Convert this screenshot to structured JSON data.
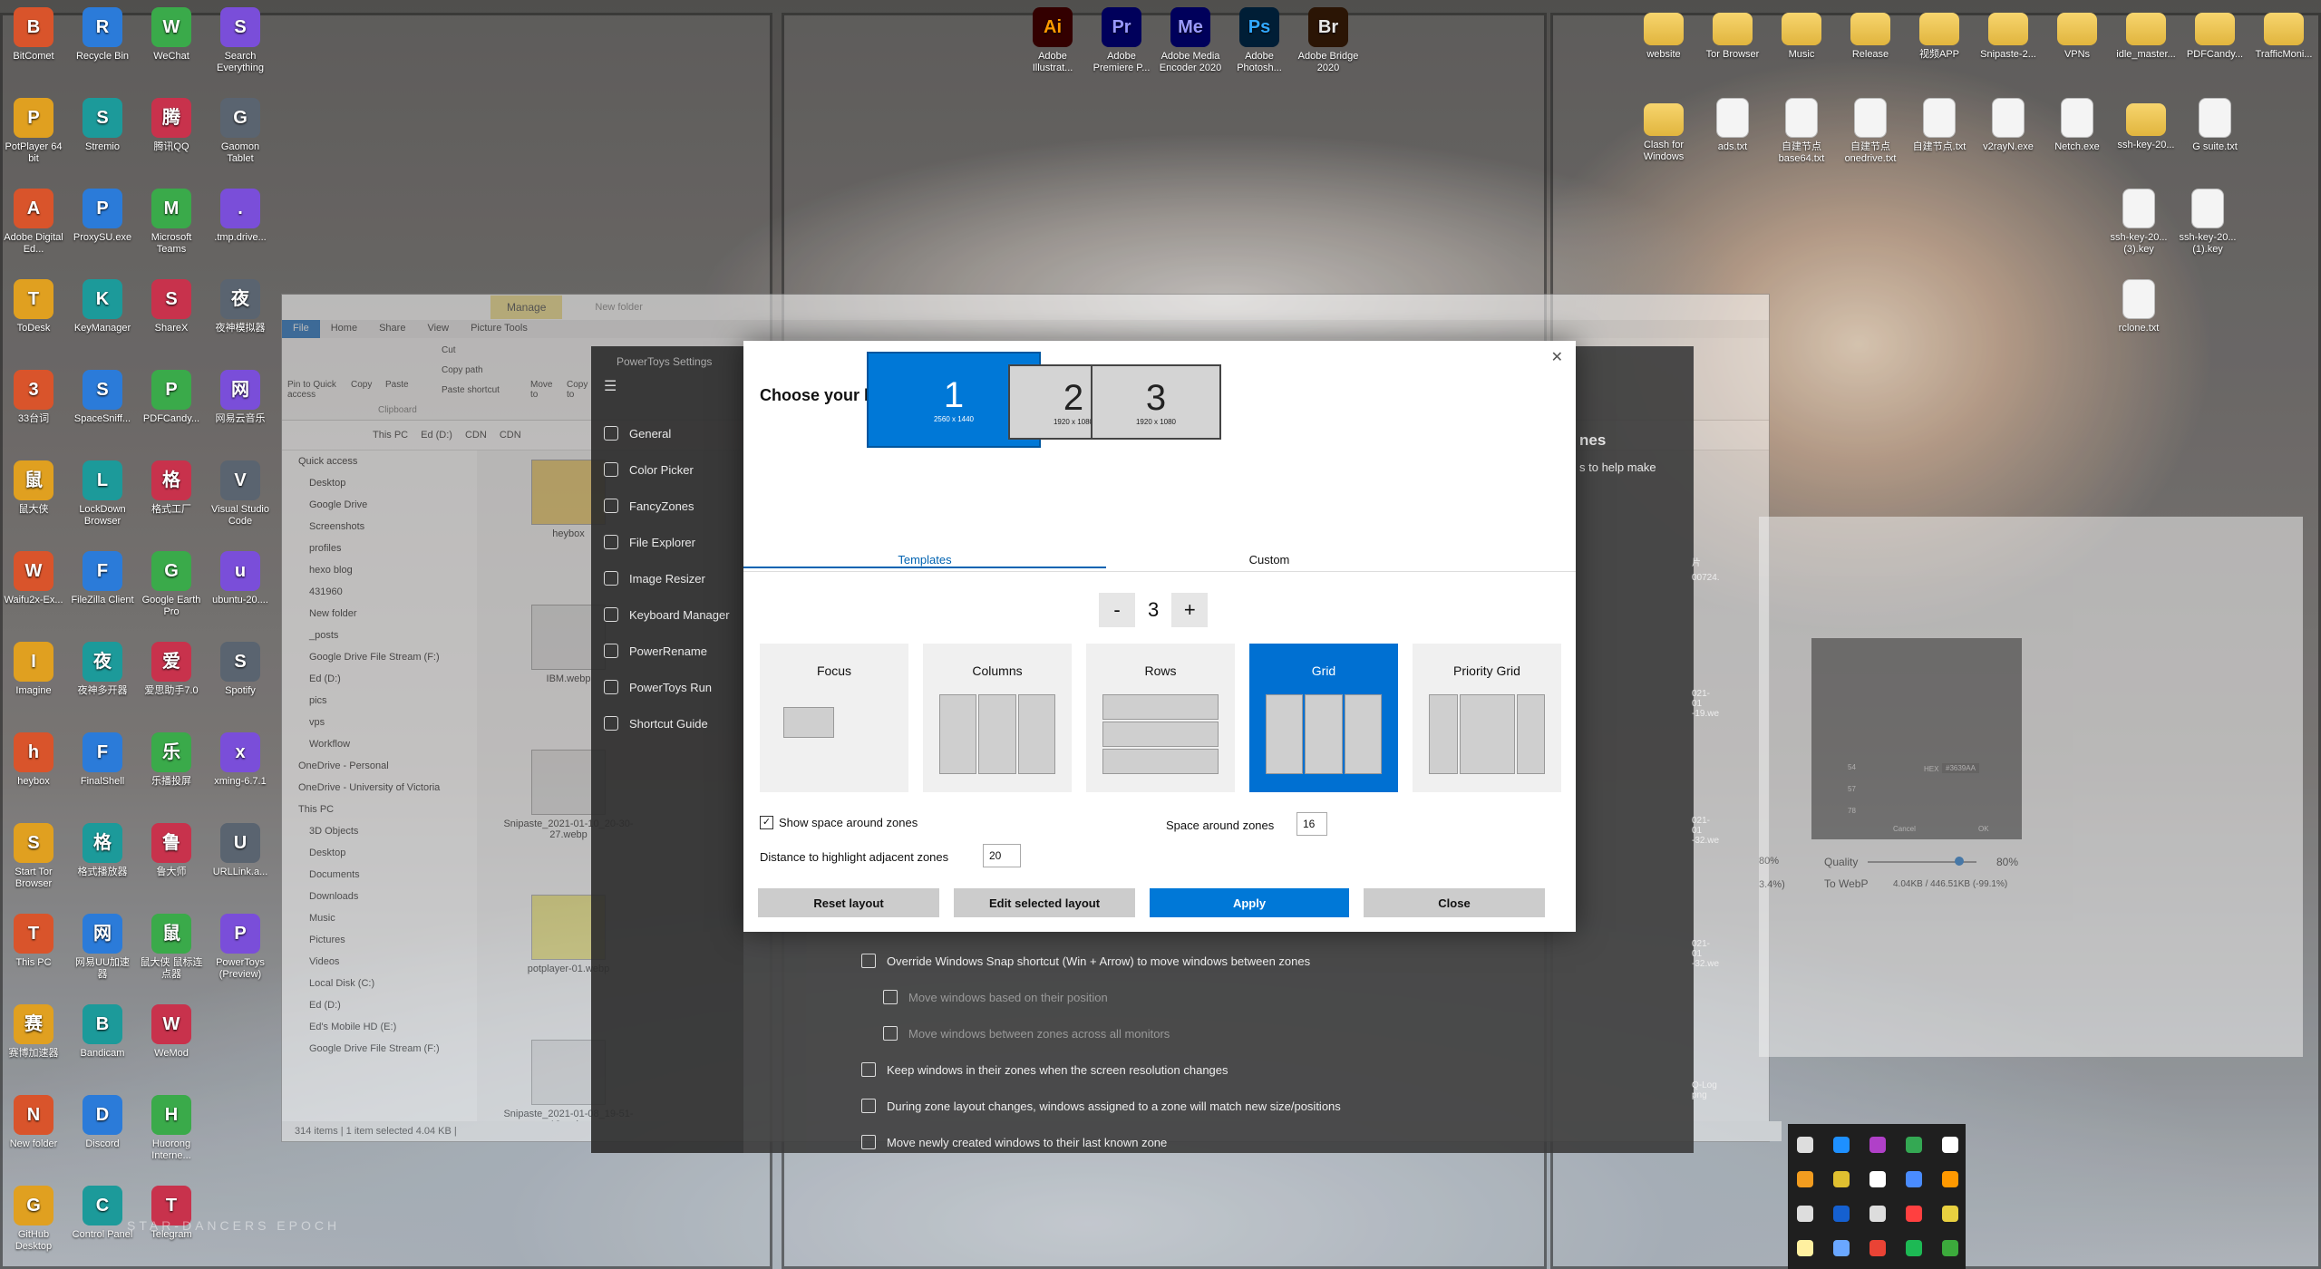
{
  "desktop": {
    "left_icons": [
      [
        "BitComet",
        "Recycle Bin",
        "WeChat",
        "Search Everything"
      ],
      [
        "PotPlayer 64 bit",
        "Stremio",
        "腾讯QQ",
        "Gaomon Tablet"
      ],
      [
        "Adobe Digital Ed...",
        "ProxySU.exe",
        "Microsoft Teams",
        ".tmp.drive..."
      ],
      [
        "ToDesk",
        "KeyManager",
        "ShareX",
        "夜神模拟器"
      ],
      [
        "33台词",
        "SpaceSniff...",
        "PDFCandy...",
        "网易云音乐"
      ],
      [
        "鼠大侠",
        "LockDown Browser",
        "格式工厂",
        "Visual Studio Code"
      ],
      [
        "Waifu2x-Ex...",
        "FileZilla Client",
        "Google Earth Pro",
        "ubuntu-20...."
      ],
      [
        "Imagine",
        "夜神多开器",
        "爱思助手7.0",
        "Spotify"
      ],
      [
        "heybox",
        "FinalShell",
        "乐播投屏",
        "xming-6.7.1"
      ],
      [
        "Start Tor Browser",
        "格式播放器",
        "鲁大师",
        "URLLink.a..."
      ],
      [
        "This PC",
        "网易UU加速器",
        "鼠大侠 鼠标连点器",
        "PowerToys (Preview)"
      ],
      [
        "赛博加速器",
        "Bandicam",
        "WeMod",
        ""
      ],
      [
        "New folder",
        "Discord",
        "Huorong Interne...",
        ""
      ],
      [
        "GitHub Desktop",
        "Control Panel",
        "Telegram",
        ""
      ]
    ],
    "top_center_icons": [
      {
        "abbr": "Ai",
        "label": "Adobe Illustrat...",
        "color": "#330000",
        "fg": "#ff9a00"
      },
      {
        "abbr": "Pr",
        "label": "Adobe Premiere P...",
        "color": "#00005b",
        "fg": "#9999ff"
      },
      {
        "abbr": "Me",
        "label": "Adobe Media Encoder 2020",
        "color": "#00005b",
        "fg": "#9999ff"
      },
      {
        "abbr": "Ps",
        "label": "Adobe Photosh...",
        "color": "#001e36",
        "fg": "#31a8ff"
      },
      {
        "abbr": "Br",
        "label": "Adobe Bridge 2020",
        "color": "#2b1505",
        "fg": "#e8e8e8"
      }
    ],
    "right_icons_row1": [
      "website",
      "Tor Browser",
      "Music",
      "Release",
      "视频APP",
      "Snipaste-2...",
      "VPNs",
      "idle_master...",
      "PDFCandy...",
      "TrafficMoni..."
    ],
    "right_icons_row2": [
      "Clash for Windows",
      "ads.txt",
      "自建节点 base64.txt",
      "自建节点 onedrive.txt",
      "自建节点.txt",
      "v2rayN.exe",
      "Netch.exe",
      "ssh-key-20...",
      "G suite.txt"
    ],
    "right_icons_row3": [
      "ssh-key-20... (3).key",
      "ssh-key-20... (1).key"
    ],
    "right_icons_row4": [
      "rclone.txt"
    ],
    "watermark": "STAR-DANCERS EPOCH"
  },
  "explorer": {
    "title": "New folder",
    "manage_tab": "Manage",
    "tabs": [
      "File",
      "Home",
      "Share",
      "View",
      "Picture Tools"
    ],
    "ribbon": {
      "pin": "Pin to Quick access",
      "copy": "Copy",
      "paste": "Paste",
      "cut": "Cut",
      "copy_path": "Copy path",
      "paste_shortcut": "Paste shortcut",
      "move_to": "Move to",
      "copy_to": "Copy to",
      "group": "Clipboard"
    },
    "address": [
      "This PC",
      "Ed (D:)",
      "CDN",
      "CDN"
    ],
    "nav": [
      {
        "label": "Quick access",
        "top": true
      },
      {
        "label": "Desktop"
      },
      {
        "label": "Google Drive"
      },
      {
        "label": "Screenshots"
      },
      {
        "label": "profiles"
      },
      {
        "label": "hexo blog"
      },
      {
        "label": "431960"
      },
      {
        "label": "New folder"
      },
      {
        "label": "_posts"
      },
      {
        "label": "Google Drive File Stream (F:)"
      },
      {
        "label": "Ed (D:)"
      },
      {
        "label": "pics"
      },
      {
        "label": "vps"
      },
      {
        "label": "Workflow"
      },
      {
        "label": "OneDrive - Personal",
        "top": true
      },
      {
        "label": "OneDrive - University of Victoria",
        "top": true
      },
      {
        "label": "This PC",
        "top": true
      },
      {
        "label": "3D Objects"
      },
      {
        "label": "Desktop"
      },
      {
        "label": "Documents"
      },
      {
        "label": "Downloads"
      },
      {
        "label": "Music"
      },
      {
        "label": "Pictures"
      },
      {
        "label": "Videos"
      },
      {
        "label": "Local Disk (C:)"
      },
      {
        "label": "Ed (D:)"
      },
      {
        "label": "Ed's Mobile HD (E:)"
      },
      {
        "label": "Google Drive File Stream (F:)"
      }
    ],
    "files": [
      "heybox",
      "IBM.webp",
      "Snipaste_2021-01-10_20-30-27.webp",
      "potplayer-01.webp",
      "Snipaste_2021-01-08_19-51-18.webp"
    ],
    "status": "314 items  |  1 item selected  4.04 KB  |"
  },
  "powertoys": {
    "title": "PowerToys Settings",
    "nav": [
      "General",
      "Color Picker",
      "FancyZones",
      "File Explorer",
      "Image Resizer",
      "Keyboard Manager",
      "PowerRename",
      "PowerToys Run",
      "Shortcut Guide"
    ],
    "options": [
      {
        "label": "Override Windows Snap shortcut (Win + Arrow) to move windows between zones",
        "sub": false
      },
      {
        "label": "Move windows based on their position",
        "sub": true
      },
      {
        "label": "Move windows between zones across all monitors",
        "sub": true
      },
      {
        "label": "Keep windows in their zones when the screen resolution changes",
        "sub": false
      },
      {
        "label": "During zone layout changes, windows assigned to a zone will match new size/positions",
        "sub": false
      },
      {
        "label": "Move newly created windows to their last known zone",
        "sub": false
      }
    ],
    "partial_heading": "nes",
    "partial_text": "s to help make"
  },
  "dialog": {
    "title": "Choose your layout for this desktop",
    "monitors": [
      {
        "num": "1",
        "res": "2560 x 1440",
        "selected": true
      },
      {
        "num": "2",
        "res": "1920 x 1080",
        "selected": false
      },
      {
        "num": "3",
        "res": "1920 x 1080",
        "selected": false
      }
    ],
    "tabs": [
      "Templates",
      "Custom"
    ],
    "zone_count": "3",
    "minus": "-",
    "plus": "+",
    "layouts": [
      {
        "label": "Focus",
        "kind": "focus",
        "selected": false
      },
      {
        "label": "Columns",
        "kind": "columns",
        "selected": false
      },
      {
        "label": "Rows",
        "kind": "rows",
        "selected": false
      },
      {
        "label": "Grid",
        "kind": "grid",
        "selected": true
      },
      {
        "label": "Priority Grid",
        "kind": "priority",
        "selected": false
      }
    ],
    "show_space_label": "Show space around zones",
    "show_space_checked": true,
    "space_around_label": "Space around zones",
    "space_around_value": "16",
    "distance_label": "Distance to highlight adjacent zones",
    "distance_value": "20",
    "buttons": [
      "Reset layout",
      "Edit selected layout",
      "Apply",
      "Close"
    ]
  },
  "right_panel": {
    "quality_label": "Quality",
    "quality_value": "80%",
    "quality_level": 0.8,
    "to_label": "To WebP",
    "size_text": "4.04KB / 446.51KB (-99.1%)",
    "pct_left": "80%",
    "pct_left2": "3.4%)",
    "hex_label": "HEX",
    "hex_value": "#3639AA",
    "r": "54",
    "g": "57",
    "b": "78",
    "cancel": "Cancel",
    "ok": "OK"
  },
  "partial_files": [
    "片",
    "00724.",
    "021-01 -19.we",
    "021-01 -32.we",
    "021-01 -32.we",
    "Q-Log png"
  ],
  "accent": "#0078d7"
}
